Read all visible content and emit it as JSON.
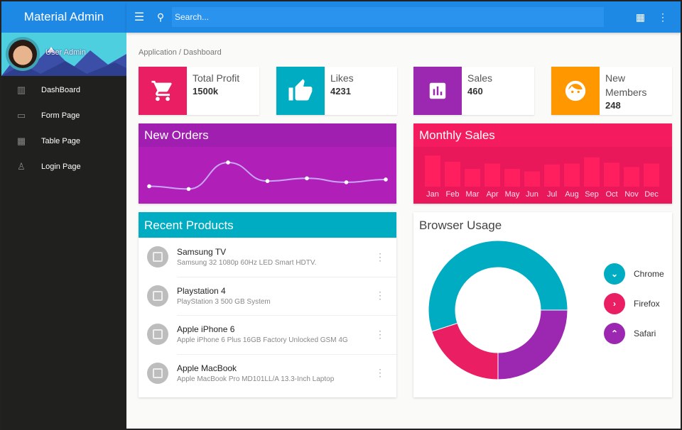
{
  "app": {
    "title": "Material Admin"
  },
  "user": {
    "name": "User Admin"
  },
  "sidebar": {
    "items": [
      {
        "label": "DashBoard",
        "icon": "bar-chart-icon"
      },
      {
        "label": "Form Page",
        "icon": "form-icon"
      },
      {
        "label": "Table Page",
        "icon": "grid-icon"
      },
      {
        "label": "Login Page",
        "icon": "person-icon"
      }
    ]
  },
  "topbar": {
    "search_placeholder": "Search...",
    "icons": [
      "menu-icon",
      "search-icon",
      "apps-grid-icon",
      "more-vert-icon"
    ]
  },
  "breadcrumb": "Application / Dashboard",
  "stats": [
    {
      "label": "Total Profit",
      "value": "1500k",
      "color": "#e91e63",
      "icon": "cart-icon"
    },
    {
      "label": "Likes",
      "value": "4231",
      "color": "#00acc1",
      "icon": "thumb-up-icon"
    },
    {
      "label": "Sales",
      "value": "460",
      "color": "#9c27b0",
      "icon": "assessment-icon"
    },
    {
      "label": "New\nMembers",
      "value": "248",
      "color": "#ff9800",
      "icon": "face-icon"
    }
  ],
  "new_orders": {
    "title": "New Orders",
    "color": "#9c27b0"
  },
  "monthly_sales": {
    "title": "Monthly Sales",
    "color": "#f0185a"
  },
  "recent_products": {
    "title": "Recent Products",
    "items": [
      {
        "name": "Samsung TV",
        "desc": "Samsung 32 1080p 60Hz LED Smart HDTV."
      },
      {
        "name": "Playstation 4",
        "desc": "PlayStation 3 500 GB System"
      },
      {
        "name": "Apple iPhone 6",
        "desc": "Apple iPhone 6 Plus 16GB Factory Unlocked GSM 4G"
      },
      {
        "name": "Apple MacBook",
        "desc": "Apple MacBook Pro MD101LL/A 13.3-Inch Laptop"
      }
    ]
  },
  "browser_usage": {
    "title": "Browser Usage"
  },
  "chart_data": [
    {
      "type": "line",
      "title": "New Orders",
      "x": [
        1,
        2,
        3,
        4,
        5,
        6,
        7
      ],
      "values": [
        3.5,
        2.8,
        9.5,
        4.8,
        5.5,
        4.5,
        5.2
      ],
      "ylim": [
        0,
        12
      ]
    },
    {
      "type": "bar",
      "title": "Monthly Sales",
      "categories": [
        "Jan",
        "Feb",
        "Mar",
        "Apr",
        "May",
        "Jun",
        "Jul",
        "Aug",
        "Sep",
        "Oct",
        "Nov",
        "Dec"
      ],
      "values": [
        35,
        28,
        20,
        26,
        20,
        17,
        25,
        26,
        33,
        27,
        22,
        26
      ],
      "ylim": [
        0,
        40
      ]
    },
    {
      "type": "pie",
      "title": "Browser Usage",
      "labels": [
        "Chrome",
        "Firefox",
        "Safari"
      ],
      "values": [
        55,
        20,
        25
      ],
      "colors": [
        "#00acc1",
        "#e91e63",
        "#9c27b0"
      ],
      "legend": "right"
    }
  ]
}
